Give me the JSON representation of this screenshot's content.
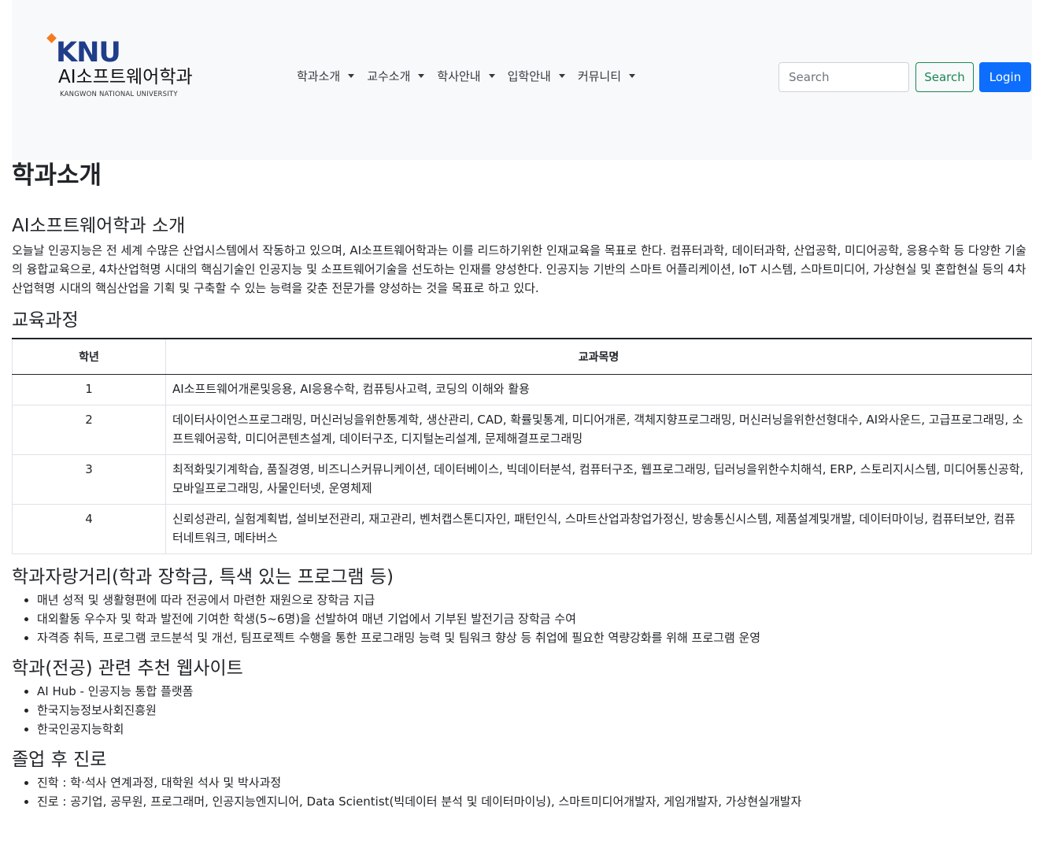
{
  "brand": {
    "logo_text": "KNU",
    "dept_name": "AI소프트웨어학과",
    "university": "KANGWON NATIONAL UNIVERSITY"
  },
  "nav": {
    "items": [
      {
        "label": "학과소개"
      },
      {
        "label": "교수소개"
      },
      {
        "label": "학사안내"
      },
      {
        "label": "입학안내"
      },
      {
        "label": "커뮤니티"
      }
    ],
    "search_placeholder": "Search",
    "search_button": "Search",
    "login_button": "Login"
  },
  "page": {
    "title": "학과소개",
    "intro_heading": "AI소프트웨어학과 소개",
    "intro_text": "오늘날 인공지능은 전 세계 수많은 산업시스템에서 작동하고 있으며, AI소프트웨어학과는 이를 리드하기위한 인재교육을 목표로 한다. 컴퓨터과학, 데이터과학, 산업공학, 미디어공학, 응용수학 등 다양한 기술의 융합교육으로, 4차산업혁명 시대의 핵심기술인 인공지능 및 소프트웨어기술을 선도하는 인재를 양성한다. 인공지능 기반의 스마트 어플리케이션, IoT 시스템, 스마트미디어, 가상현실 및 혼합현실 등의 4차산업혁명 시대의 핵심산업을 기획 및 구축할 수 있는 능력을 갖춘 전문가를 양성하는 것을 목표로 하고 있다.",
    "curriculum_heading": "교육과정",
    "curriculum": {
      "headers": [
        "학년",
        "교과목명"
      ],
      "rows": [
        {
          "grade": "1",
          "courses": "AI소프트웨어개론및응용, AI응용수학, 컴퓨팅사고력,  코딩의 이해와 활용"
        },
        {
          "grade": "2",
          "courses": "데이터사이언스프로그래밍, 머신러닝을위한통계학, 생산관리, CAD, 확률및통계, 미디어개론, 객체지향프로그래밍, 머신러닝을위한선형대수, AI와사운드, 고급프로그래밍, 소프트웨어공학, 미디어콘텐츠설계, 데이터구조, 디지털논리설계, 문제해결프로그래밍"
        },
        {
          "grade": "3",
          "courses": "최적화및기계학습, 품질경영, 비즈니스커뮤니케이션, 데이터베이스, 빅데이터분석, 컴퓨터구조, 웹프로그래밍, 딥러닝을위한수치해석, ERP, 스토리지시스템, 미디어통신공학, 모바일프로그래밍, 사물인터넷, 운영체제"
        },
        {
          "grade": "4",
          "courses": "신뢰성관리, 실험계획법, 설비보전관리, 재고관리, 벤처캡스톤디자인, 패턴인식, 스마트산업과창업가정신, 방송통신시스템, 제품설계및개발, 데이터마이닝, 컴퓨터보안, 컴퓨터네트워크, 메타버스"
        }
      ]
    },
    "pride_heading": "학과자랑거리(학과 장학금, 특색 있는 프로그램 등)",
    "pride_items": [
      "매년 성적 및 생활형편에 따라 전공에서 마련한 재원으로 장학금 지급",
      "대외활동 우수자 및 학과 발전에 기여한 학생(5~6명)을 선발하여 매년 기업에서 기부된 발전기금 장학금 수여",
      "자격증 취득, 프로그램 코드분석 및 개선, 팀프로젝트 수행을 통한 프로그래밍 능력 및 팀워크 향상 등 취업에 필요한 역량강화를 위해 프로그램 운영"
    ],
    "sites_heading": "학과(전공) 관련 추천 웹사이트",
    "sites": [
      "AI Hub - 인공지능 통합 플랫폼",
      "한국지능정보사회진흥원",
      "한국인공지능학회"
    ],
    "career_heading": "졸업 후 진로",
    "career_items": [
      "진학 : 학·석사 연계과정, 대학원 석사 및 박사과정",
      "진로 : 공기업, 공무원, 프로그래머, 인공지능엔지니어, Data Scientist(빅데이터 분석 및 데이터마이닝), 스마트미디어개발자, 게임개발자, 가상현실개발자"
    ]
  }
}
